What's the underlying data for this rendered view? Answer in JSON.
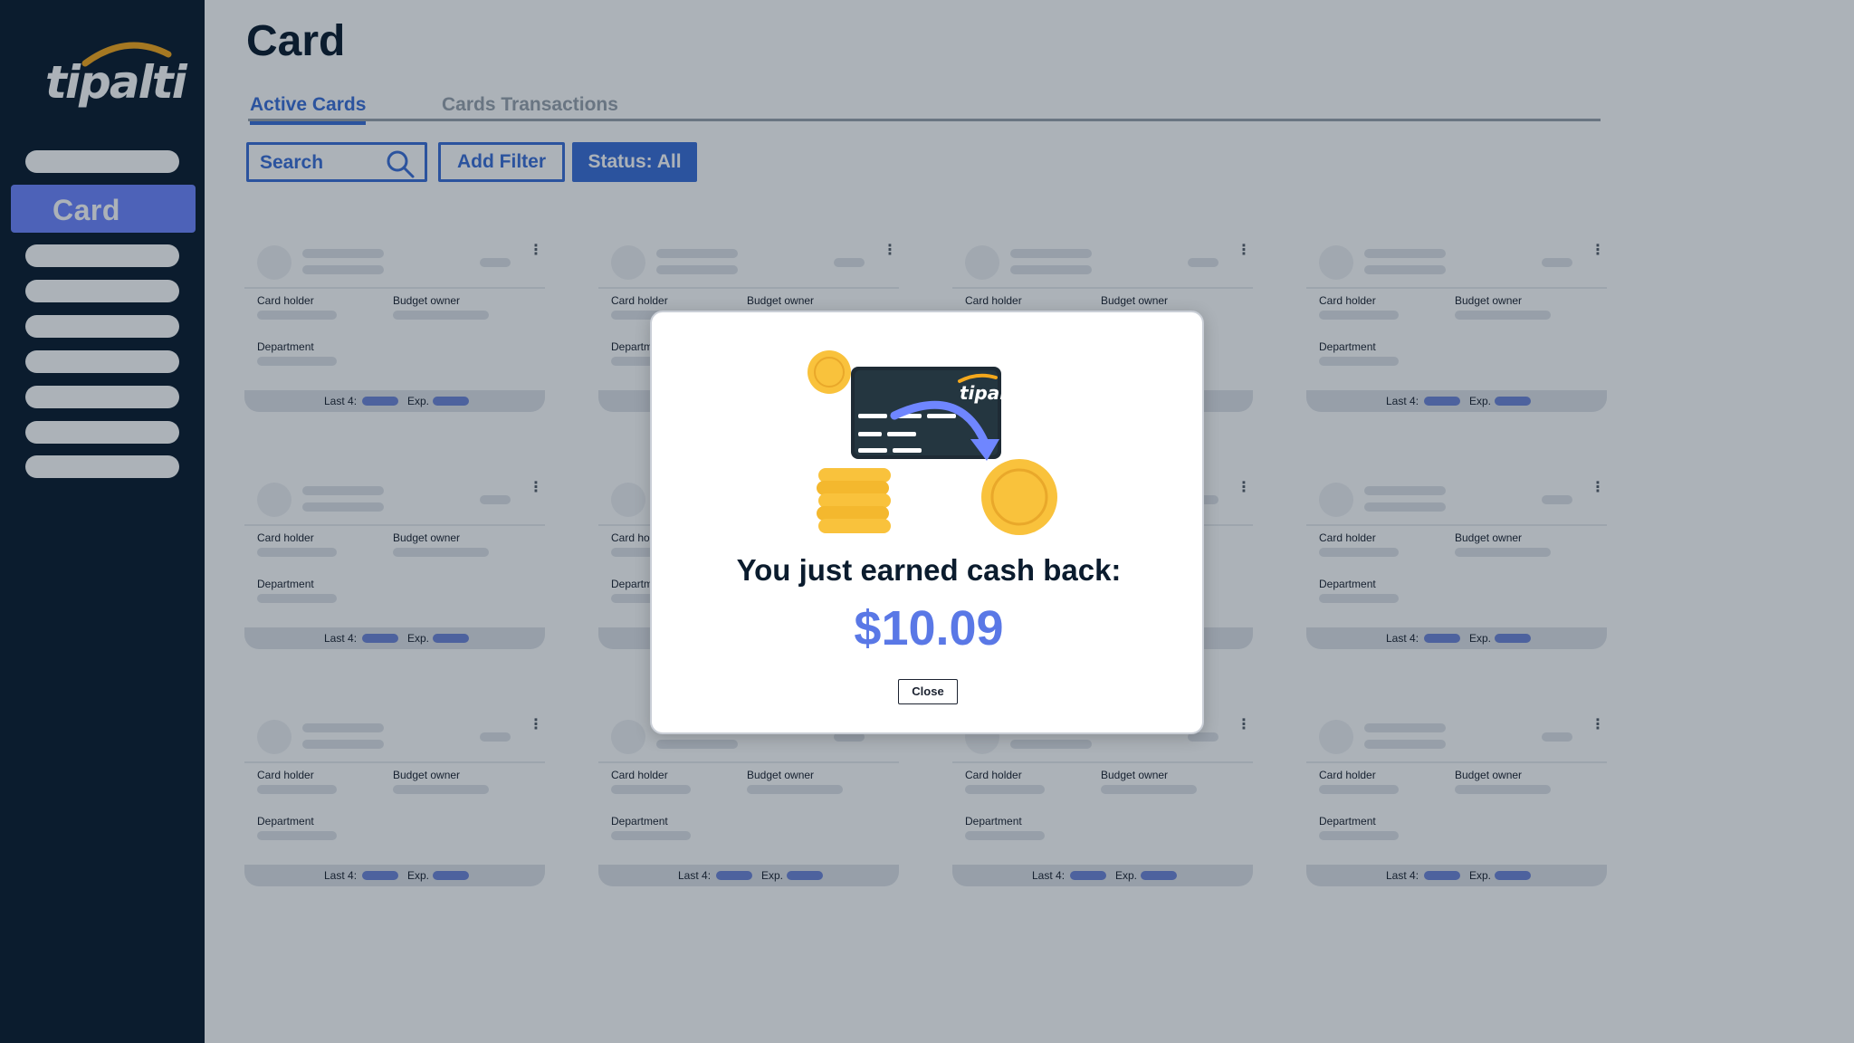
{
  "sidebar": {
    "logo_text": "tipalti",
    "active_item": "Card"
  },
  "header": {
    "title": "Card"
  },
  "tabs": [
    {
      "label": "Active Cards",
      "active": true
    },
    {
      "label": "Cards Transactions",
      "active": false
    }
  ],
  "toolbar": {
    "search_placeholder": "Search",
    "add_filter_label": "Add Filter",
    "status_label": "Status: All"
  },
  "card_labels": {
    "card_holder": "Card holder",
    "budget_owner": "Budget owner",
    "department": "Department",
    "last4": "Last 4:",
    "exp": "Exp."
  },
  "modal": {
    "card_brand": "tipalti",
    "heading": "You just earned cash back:",
    "amount": "$10.09",
    "close_label": "Close"
  },
  "colors": {
    "sidebar_bg": "#0b1c2e",
    "accent": "#3c6fd8",
    "active_nav": "#6f86ff",
    "amount": "#5a78e6",
    "coin": "#f9c23c"
  }
}
